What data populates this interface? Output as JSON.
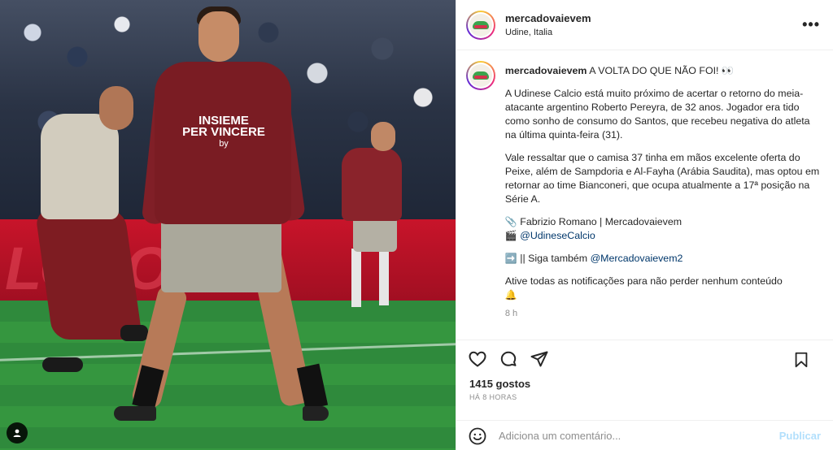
{
  "header": {
    "username": "mercadovaievem",
    "location": "Udine, Italia",
    "more_icon": "•••"
  },
  "photo": {
    "ad_text": "LOCOO",
    "shirt_text_1": "INSIEME",
    "shirt_text_2": "PER VINCERE",
    "shirt_text_3": "by",
    "user_tag_icon": "person-icon"
  },
  "caption": {
    "username": "mercadovaievem",
    "headline": "A VOLTA DO QUE NÃO FOI! 👀",
    "p1": "A Udinese Calcio está muito próximo de acertar o retorno do meia-atacante argentino Roberto Pereyra, de 32 anos. Jogador era tido como sonho de consumo do Santos, que recebeu negativa do atleta na última quinta-feira (31).",
    "p2": "Vale ressaltar que o camisa 37 tinha em mãos excelente oferta do Peixe, além de Sampdoria e Al-Fayha (Arábia Saudita), mas optou em retornar ao time Bianconeri, que ocupa atualmente a 17ª posição na Série A.",
    "credit_emoji": "📎",
    "credit": "Fabrizio Romano | Mercadovaievem",
    "clapper_emoji": "🎬",
    "photo_credit": "@UdineseCalcio",
    "follow_emoji": "➡️",
    "follow_prefix": "|| Siga também",
    "follow_link": "@Mercadovaievem2",
    "notify": "Ative todas as notificações para não perder nenhum conteúdo",
    "bell_emoji": "🔔",
    "time": "8 h"
  },
  "actions": {
    "likes": "1415 gostos",
    "ago": "HÁ 8 HORAS",
    "comment_placeholder": "Adiciona um comentário...",
    "publish": "Publicar"
  }
}
